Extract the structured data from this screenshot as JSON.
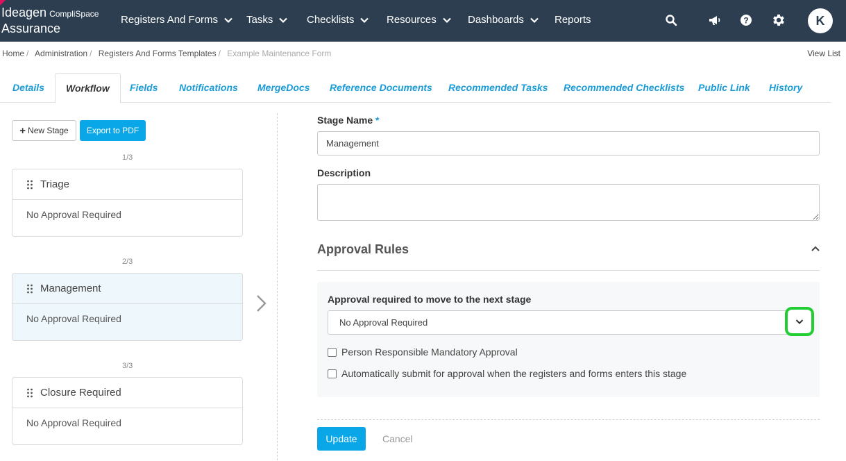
{
  "header": {
    "logo_brand": "Ideagen",
    "logo_sub": "CompliSpace",
    "logo_product": "Assurance",
    "nav": [
      {
        "label": "Registers And Forms",
        "has_dropdown": true
      },
      {
        "label": "Tasks",
        "has_dropdown": true
      },
      {
        "label": "Checklists",
        "has_dropdown": true
      },
      {
        "label": "Resources",
        "has_dropdown": true
      },
      {
        "label": "Dashboards",
        "has_dropdown": true
      },
      {
        "label": "Reports",
        "has_dropdown": false
      }
    ],
    "icons": [
      "search-icon",
      "megaphone-icon",
      "help-icon",
      "gear-icon"
    ],
    "avatar_initial": "K"
  },
  "breadcrumb": {
    "items": [
      "Home",
      "Administration",
      "Registers And Forms Templates"
    ],
    "current": "Example Maintenance Form",
    "view_list": "View List"
  },
  "tabs": {
    "items": [
      "Details",
      "Workflow",
      "Fields",
      "Notifications",
      "MergeDocs",
      "Reference Documents",
      "Recommended Tasks",
      "Recommended Checklists",
      "Public Link",
      "History"
    ],
    "active": "Workflow"
  },
  "left": {
    "new_stage_label": "New Stage",
    "export_label": "Export to PDF",
    "stages": [
      {
        "counter": "1/3",
        "name": "Triage",
        "approval": "No Approval Required",
        "selected": false
      },
      {
        "counter": "2/3",
        "name": "Management",
        "approval": "No Approval Required",
        "selected": true
      },
      {
        "counter": "3/3",
        "name": "Closure Required",
        "approval": "No Approval Required",
        "selected": false
      }
    ]
  },
  "form": {
    "stage_name_label": "Stage Name",
    "required_marker": "*",
    "stage_name_value": "Management",
    "description_label": "Description",
    "description_value": "",
    "approval_rules_title": "Approval Rules",
    "approval_required_label": "Approval required to move to the next stage",
    "approval_select_value": "No Approval Required",
    "chk_person_responsible": "Person Responsible Mandatory Approval",
    "chk_auto_submit": "Automatically submit for approval when the registers and forms enters this stage",
    "update_label": "Update",
    "cancel_label": "Cancel"
  },
  "colors": {
    "nav_bg": "#2c3e50",
    "accent": "#0aa7e8",
    "tab_link": "#1a9bd7",
    "highlight": "#22cc33"
  }
}
